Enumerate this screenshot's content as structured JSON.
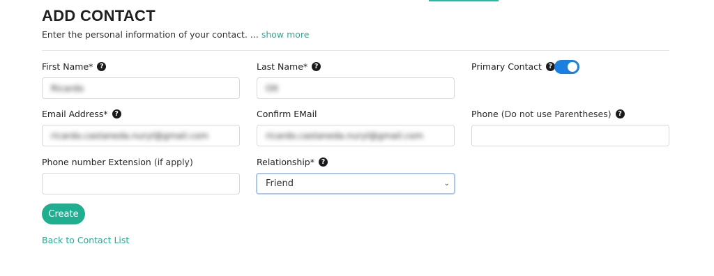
{
  "header": {
    "title": "ADD CONTACT",
    "subtitle": "Enter the personal information of your contact. ... ",
    "show_more": "show more"
  },
  "form": {
    "first_name": {
      "label": "First Name*",
      "value": "Ricardo"
    },
    "last_name": {
      "label": "Last Name*",
      "value": "Olt"
    },
    "primary_contact": {
      "label": "Primary Contact",
      "enabled": true
    },
    "email": {
      "label": "Email Address*",
      "value": "ricardo.castaneda.nuryl@gmail.com"
    },
    "confirm_email": {
      "label": "Confirm EMail",
      "value": "ricardo.castaneda.nuryl@gmail.com"
    },
    "phone": {
      "label": "Phone",
      "suffix": "(Do not use Parentheses)",
      "value": ""
    },
    "extension": {
      "label": "Phone number Extension",
      "suffix": "(if apply)",
      "value": ""
    },
    "relationship": {
      "label": "Relationship*",
      "selected": "Friend"
    }
  },
  "actions": {
    "create_label": "Create",
    "back_label": "Back to Contact List"
  },
  "icons": {
    "help": "question-circle-icon",
    "chevron": "chevron-down-icon"
  },
  "colors": {
    "accent": "#1fae8f",
    "link": "#2aa891",
    "toggle": "#1a7fe0",
    "focus_border": "#a8c8f0"
  }
}
